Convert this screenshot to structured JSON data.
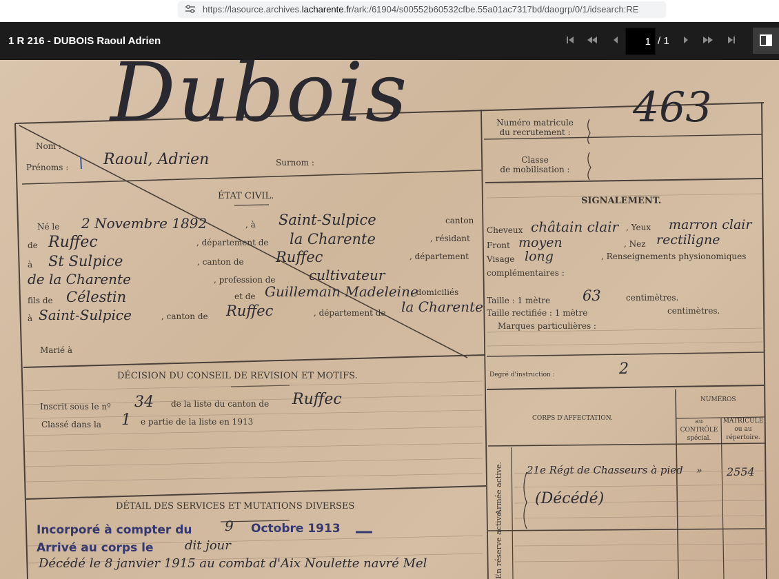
{
  "browser": {
    "url_prefix": "https://lasource.archives.",
    "url_domain": "lacharente.fr",
    "url_suffix": "/ark:/61904/s00552b60532cfbe.55a01ac7317bd/daogrp/0/1/idsearch:RE"
  },
  "viewer": {
    "title": "1 R 216 - DUBOIS Raoul Adrien",
    "current_page": "1",
    "page_total": "/ 1"
  },
  "document": {
    "surname_hw": "Dubois",
    "matricule_hw": "463",
    "left": {
      "nom_label": "Nom :",
      "prenoms_label": "Prénoms :",
      "prenoms_hw": "Raoul, Adrien",
      "surnom_label": "Surnom :",
      "etat_civil_title": "ÉTAT CIVIL.",
      "ne_le": "Né le",
      "birth_date_hw": "2 Novembre 1892",
      "a": ", à",
      "birth_place_hw": "Saint-Sulpice",
      "canton": "canton",
      "de": "de",
      "canton_hw": "Ruffec",
      "departement_de": ", département de",
      "dept_hw": "la Charente",
      "residant": ", résidant",
      "a2": "à",
      "residence_hw": "St Sulpice",
      "canton_de": ", canton de",
      "res_canton_hw": "Ruffec",
      "departement": ", département",
      "res_dept_hw": "de la Charente",
      "profession_de": ", profession de",
      "profession_hw": "cultivateur",
      "fils_de": "fils de",
      "father_hw": "Célestin",
      "et_de": "et de",
      "mother_hw": "Guillemain Madeleine",
      "domicilies": ", domiciliés",
      "a3": "à",
      "parents_place_hw": "Saint-Sulpice",
      "canton_de2": ", canton de",
      "parents_canton_hw": "Ruffec",
      "departement_de2": ", département de",
      "parents_dept_hw": "la Charente",
      "marie_a": "Marié à",
      "decision_title": "DÉCISION DU CONSEIL DE REVISION ET MOTIFS.",
      "inscrit_sous": "Inscrit sous le nº",
      "inscrit_hw": "34",
      "de_la_liste": "de la liste du canton de",
      "list_canton_hw": "Ruffec",
      "classe_dans": "Classé dans la",
      "partie_hw": "1",
      "partie_text": "e partie de la liste en 1913",
      "detail_title": "DÉTAIL DES SERVICES ET MUTATIONS DIVERSES",
      "stamp_incorpore": "Incorporé à compter du",
      "incorpore_day_hw": "9",
      "stamp_octobre": "Octobre 1913",
      "stamp_arrive": "Arrivé au corps le",
      "arrive_hw": "dit jour",
      "deces_hw": "Décédé le 8 janvier 1915 au combat d'Aix Noulette navré Mel"
    },
    "right": {
      "numero_matricule": "Numéro matricule",
      "du_recrutement": "du recrutement :",
      "classe": "Classe",
      "de_mobilisation": "de mobilisation :",
      "signalement_title": "SIGNALEMENT.",
      "cheveux": "Cheveux",
      "cheveux_hw": "châtain clair",
      "yeux": ", Yeux",
      "yeux_hw": "marron clair",
      "front": "Front",
      "front_hw": "moyen",
      "nez": ", Nez",
      "nez_hw": "rectiligne",
      "visage": "Visage",
      "visage_hw": "long",
      "renseignements": ", Renseignements physionomiques",
      "complementaires": "complémentaires :",
      "taille": "Taille : 1 mètre",
      "taille_hw": "63",
      "centimetres": "centimètres.",
      "taille_rectifiee": "Taille rectifiée : 1 mètre",
      "centimetres2": "centimètres.",
      "marques": "Marques particulières :",
      "degre": "Degré d'instruction :",
      "degre_hw": "2",
      "numeros": "NUMÉROS",
      "corps_affectation": "CORPS D'AFFECTATION.",
      "au_controle_1": "au",
      "au_controle_2": "CONTRÔLE",
      "au_controle_3": "spécial.",
      "matricule_1": "MATRICULE",
      "matricule_2": "ou au",
      "matricule_3": "répertoire.",
      "armee_active": "Armée active.",
      "corps_hw": "21e Régt de Chasseurs à pied",
      "controle_hw": "»",
      "matricule_hw": "2554",
      "decede_hw": "(Décédé)",
      "reserve_label": "En réserve active."
    }
  }
}
